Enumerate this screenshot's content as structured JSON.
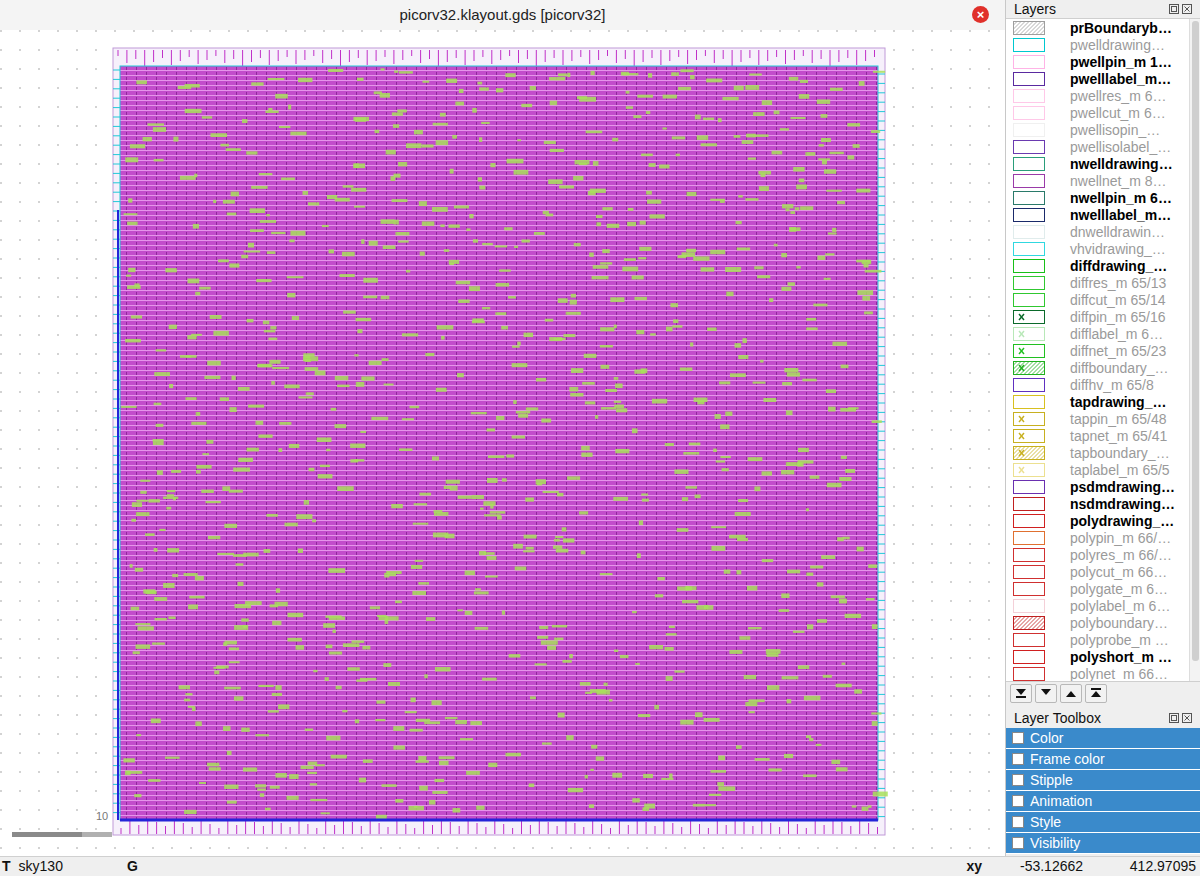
{
  "window": {
    "title": "picorv32.klayout.gds [picorv32]",
    "close": "×"
  },
  "canvas": {
    "scale_label": "10"
  },
  "layers_panel": {
    "title": "Layers",
    "layers": [
      {
        "name": "prBoundaryb…",
        "visible": true,
        "color": "#9e9e9e",
        "kind": "hatch"
      },
      {
        "name": "pwelldrawing…",
        "visible": false,
        "color": "#00c8d0",
        "kind": "frame"
      },
      {
        "name": "pwellpin_m 1…",
        "visible": true,
        "color": "#ffb3e6",
        "kind": "frame"
      },
      {
        "name": "pwelllabel_m…",
        "visible": true,
        "color": "#5a2aa0",
        "kind": "frame"
      },
      {
        "name": "pwellres_m 6…",
        "visible": false,
        "color": "#ffc8e8",
        "kind": "frame"
      },
      {
        "name": "pwellcut_m 6…",
        "visible": false,
        "color": "#ffc8e8",
        "kind": "frame"
      },
      {
        "name": "pwellisopin_…",
        "visible": false,
        "color": "#f0f0f0",
        "kind": "frame"
      },
      {
        "name": "pwellisolabel_…",
        "visible": false,
        "color": "#6a3ab0",
        "kind": "frame"
      },
      {
        "name": "nwelldrawing…",
        "visible": true,
        "color": "#2a9d7a",
        "kind": "frame"
      },
      {
        "name": "nwellnet_m 8…",
        "visible": false,
        "color": "#9a3aa8",
        "kind": "frame"
      },
      {
        "name": "nwellpin_m 6…",
        "visible": true,
        "color": "#2a7a6a",
        "kind": "frame"
      },
      {
        "name": "nwelllabel_m…",
        "visible": true,
        "color": "#1a2a6a",
        "kind": "frame"
      },
      {
        "name": "dnwelldrawin…",
        "visible": false,
        "color": "#e0ecec",
        "kind": "frame"
      },
      {
        "name": "vhvidrawing_…",
        "visible": false,
        "color": "#30d8e0",
        "kind": "frame"
      },
      {
        "name": "diffdrawing_…",
        "visible": true,
        "color": "#18c018",
        "kind": "frame"
      },
      {
        "name": "diffres_m 65/13",
        "visible": false,
        "color": "#30c830",
        "kind": "frame"
      },
      {
        "name": "diffcut_m 65/14",
        "visible": false,
        "color": "#30c830",
        "kind": "frame"
      },
      {
        "name": "diffpin_m 65/16",
        "visible": false,
        "color": "#0a6a2a",
        "kind": "cross"
      },
      {
        "name": "difflabel_m 6…",
        "visible": false,
        "color": "#b8e8b8",
        "kind": "cross"
      },
      {
        "name": "diffnet_m 65/23",
        "visible": false,
        "color": "#20c020",
        "kind": "cross"
      },
      {
        "name": "diffboundary_…",
        "visible": false,
        "color": "#20b020",
        "kind": "crosshatch"
      },
      {
        "name": "diffhv_m 65/8",
        "visible": false,
        "color": "#6030c0",
        "kind": "frame"
      },
      {
        "name": "tapdrawing_…",
        "visible": true,
        "color": "#d8c020",
        "kind": "frame"
      },
      {
        "name": "tappin_m 65/48",
        "visible": false,
        "color": "#c8b020",
        "kind": "cross"
      },
      {
        "name": "tapnet_m 65/41",
        "visible": false,
        "color": "#c8b020",
        "kind": "cross"
      },
      {
        "name": "tapboundary_…",
        "visible": false,
        "color": "#c8b020",
        "kind": "crosshatch"
      },
      {
        "name": "taplabel_m 65/5",
        "visible": false,
        "color": "#ece090",
        "kind": "cross"
      },
      {
        "name": "psdmdrawing…",
        "visible": true,
        "color": "#6a30b0",
        "kind": "frame"
      },
      {
        "name": "nsdmdrawing…",
        "visible": true,
        "color": "#c02020",
        "kind": "frame"
      },
      {
        "name": "polydrawing_…",
        "visible": true,
        "color": "#d02020",
        "kind": "frame"
      },
      {
        "name": "polypin_m 66/…",
        "visible": false,
        "color": "#e07030",
        "kind": "frame"
      },
      {
        "name": "polyres_m 66/…",
        "visible": false,
        "color": "#d03030",
        "kind": "frame"
      },
      {
        "name": "polycut_m 66…",
        "visible": false,
        "color": "#d03030",
        "kind": "frame"
      },
      {
        "name": "polygate_m 6…",
        "visible": false,
        "color": "#d03030",
        "kind": "frame"
      },
      {
        "name": "polylabel_m 6…",
        "visible": false,
        "color": "#f4d0d8",
        "kind": "frame"
      },
      {
        "name": "polyboundary…",
        "visible": false,
        "color": "#c02020",
        "kind": "hatch"
      },
      {
        "name": "polyprobe_m …",
        "visible": false,
        "color": "#d03030",
        "kind": "frame"
      },
      {
        "name": "polyshort_m …",
        "visible": true,
        "color": "#d02020",
        "kind": "frame"
      },
      {
        "name": "polynet_m 66…",
        "visible": false,
        "color": "#d03030",
        "kind": "frame"
      }
    ]
  },
  "layer_toolbox": {
    "title": "Layer Toolbox",
    "items": [
      {
        "label": "Color",
        "checked": false
      },
      {
        "label": "Frame color",
        "checked": false
      },
      {
        "label": "Stipple",
        "checked": false
      },
      {
        "label": "Animation",
        "checked": false
      },
      {
        "label": "Style",
        "checked": false
      },
      {
        "label": "Visibility",
        "checked": false
      }
    ]
  },
  "status_bar": {
    "tech_prefix": "T",
    "tech": "sky130",
    "grid": "G",
    "coord_label": "xy",
    "x": "-53.12662",
    "y": "412.97095"
  }
}
